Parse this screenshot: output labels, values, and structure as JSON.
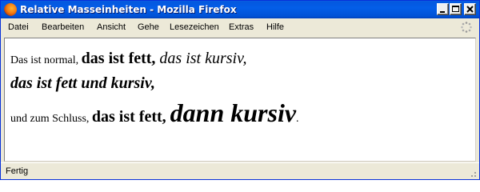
{
  "window": {
    "title": "Relative Masseinheiten - Mozilla Firefox",
    "icon": "firefox-icon"
  },
  "menu": {
    "items": [
      "Datei",
      "Bearbeiten",
      "Ansicht",
      "Gehe",
      "Lesezeichen",
      "Extras",
      "Hilfe"
    ]
  },
  "content": {
    "line1": {
      "normal": "Das ist normal, ",
      "bold": "das ist fett, ",
      "italic": "das ist kursiv,"
    },
    "line2": {
      "bolditalic": "das ist fett und kursiv,"
    },
    "line3": {
      "small": "und zum Schluss, ",
      "bold": "das ist fett, ",
      "big_bolditalic": "dann kursiv",
      "period": "."
    }
  },
  "status": {
    "text": "Fertig"
  },
  "colors": {
    "titlebar": "#0458df",
    "chrome": "#ece9d8",
    "content_bg": "#ffffff"
  }
}
